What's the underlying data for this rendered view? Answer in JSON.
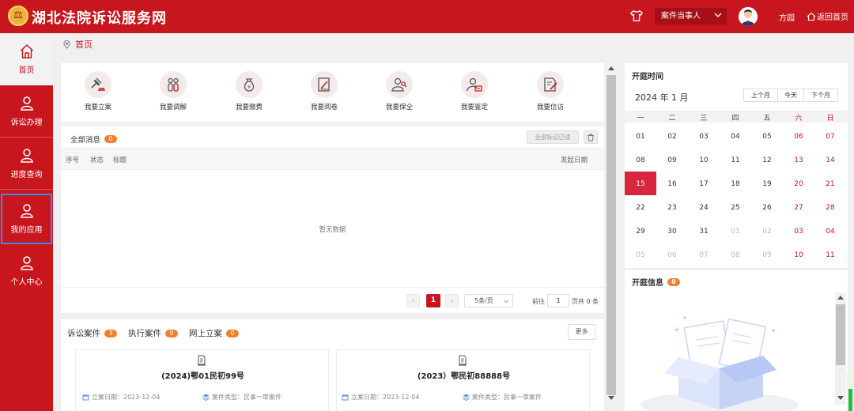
{
  "header": {
    "logo_glyph": "⚖",
    "title": "湖北法院诉讼服务网",
    "role": "案件当事人",
    "user": "方园",
    "home_link": "返回首页"
  },
  "sidebar": {
    "items": [
      {
        "label": "首页",
        "icon": "home-icon",
        "active": true
      },
      {
        "label": "诉讼办理",
        "icon": "user-icon"
      },
      {
        "label": "进度查询",
        "icon": "user-icon"
      },
      {
        "label": "我的应用",
        "icon": "user-icon",
        "selected": true
      },
      {
        "label": "个人中心",
        "icon": "user-icon"
      }
    ]
  },
  "breadcrumb": "首页",
  "quick_actions": [
    {
      "label": "我要立案",
      "icon": "gavel-icon"
    },
    {
      "label": "我要调解",
      "icon": "people-icon"
    },
    {
      "label": "我要缴费",
      "icon": "moneybag-icon"
    },
    {
      "label": "我要阅卷",
      "icon": "document-edit-icon"
    },
    {
      "label": "我要保全",
      "icon": "person-search-icon"
    },
    {
      "label": "我要鉴定",
      "icon": "person-card-icon"
    },
    {
      "label": "我要信访",
      "icon": "letter-edit-icon"
    }
  ],
  "messages": {
    "title": "全部消息",
    "count": "0",
    "mark_all": "全部标记已读",
    "columns": {
      "no": "序号",
      "status": "状态",
      "title": "标题",
      "date": "发起日期"
    },
    "empty_text": "暂无数据",
    "pager": {
      "prev": "‹",
      "current": "1",
      "next": "›",
      "page_size": "5条/页",
      "goto_label": "前往",
      "goto_value": "1",
      "total": "页共 0 条"
    }
  },
  "cases": {
    "tabs": [
      {
        "label": "诉讼案件",
        "count": "3"
      },
      {
        "label": "执行案件",
        "count": "0"
      },
      {
        "label": "网上立案",
        "count": "0"
      }
    ],
    "more": "更多",
    "cards": [
      {
        "case_no": "(2024)鄂01民初99号",
        "date_label": "立案日期：2023-12-04",
        "type_label": "案件类型：民事一审案件"
      },
      {
        "case_no": "(2023）鄂民初88888号",
        "date_label": "立案日期：2023-12-04",
        "type_label": "案件类型：民事一审案件"
      }
    ]
  },
  "calendar": {
    "title": "开庭时间",
    "month": "2024 年 1 月",
    "buttons": [
      "上个月",
      "今天",
      "下个月"
    ],
    "weekdays": [
      "一",
      "二",
      "三",
      "四",
      "五",
      "六",
      "日"
    ],
    "weeks": [
      [
        "01",
        "02",
        "03",
        "04",
        "05",
        "06",
        "07"
      ],
      [
        "08",
        "09",
        "10",
        "11",
        "12",
        "13",
        "14"
      ],
      [
        "15",
        "16",
        "17",
        "18",
        "19",
        "20",
        "21"
      ],
      [
        "22",
        "23",
        "24",
        "25",
        "26",
        "27",
        "28"
      ],
      [
        "29",
        "30",
        "31",
        "01",
        "02",
        "03",
        "04"
      ],
      [
        "05",
        "06",
        "07",
        "08",
        "09",
        "10",
        "11"
      ]
    ],
    "today": "15"
  },
  "hearing": {
    "title": "开庭信息",
    "count": "0"
  },
  "colors": {
    "brand_red": "#c8161e",
    "badge_orange": "#f08030",
    "today_red": "#d7263d",
    "selection_blue": "#3a8ee6"
  }
}
